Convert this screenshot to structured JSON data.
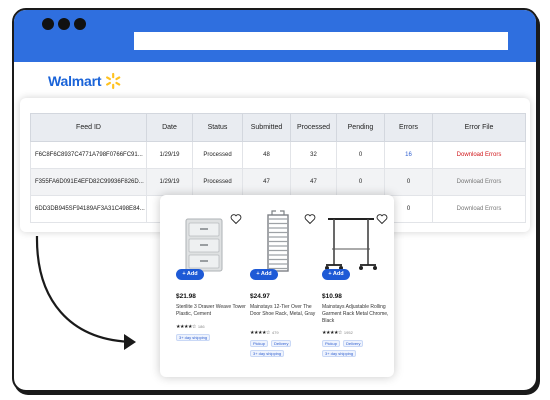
{
  "brand": {
    "name": "Walmart",
    "spark_color": "#ffc220",
    "text_color": "#1a63d8"
  },
  "window": {
    "titlebar_color": "#2f6fdf"
  },
  "table": {
    "headers": [
      "Feed ID",
      "Date",
      "Status",
      "Submitted",
      "Processed",
      "Pending",
      "Errors",
      "Error File"
    ],
    "rows": [
      {
        "feed_id": "F6C8F6C8937C4771A798F0766FC91...",
        "date": "1/29/19",
        "status": "Processed",
        "submitted": "48",
        "processed": "32",
        "pending": "0",
        "errors": "16",
        "error_file": "Download Errors"
      },
      {
        "feed_id": "F355FA6D091E4EFD82C99936F826D...",
        "date": "1/29/19",
        "status": "Processed",
        "submitted": "47",
        "processed": "47",
        "pending": "0",
        "errors": "0",
        "error_file": "Download Errors"
      },
      {
        "feed_id": "6DD3DB945SF94189AF3A31C498E84...",
        "date": "1/",
        "status": "",
        "submitted": "",
        "processed": "",
        "pending": "",
        "errors": "0",
        "error_file": "Download Errors"
      }
    ]
  },
  "products": [
    {
      "price": "$21.98",
      "name": "Sterilite 3 Drawer Weave Tower Plastic, Cement",
      "reviews": "186",
      "add_label": "+ Add",
      "tags": [
        "3+ day shipping"
      ]
    },
    {
      "price": "$24.97",
      "name": "Mainstays 12-Tier Over The Door Shoe Rack, Metal, Gray",
      "reviews": "479",
      "add_label": "+ Add",
      "tags": [
        "Pickup",
        "Delivery",
        "3+ day shipping"
      ]
    },
    {
      "price": "$10.98",
      "name": "Mainstays Adjustable Rolling Garment Rack Metal Chrome, Black",
      "reviews": "1952",
      "add_label": "+ Add",
      "tags": [
        "Pickup",
        "Delivery",
        "3+ day shipping"
      ]
    }
  ],
  "icons": {
    "heart": "heart-icon",
    "spark": "walmart-spark-icon",
    "arrow": "curved-arrow-icon"
  }
}
